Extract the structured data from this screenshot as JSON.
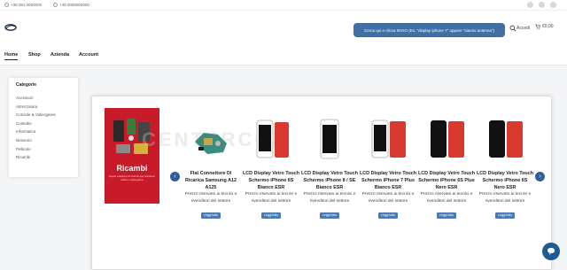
{
  "topbar": {
    "phone": "+39 081 0000000",
    "phone2": "+39 0000000000"
  },
  "header": {
    "search_label": "Cerca qui e clicca INVIO (Es. \"display iphone 7\" oppure \"xiaomi antenna\")",
    "account_label": "Accedi",
    "cart_label": "€0,00"
  },
  "nav": {
    "items": [
      "Home",
      "Shop",
      "Azienda",
      "Account"
    ]
  },
  "categories": {
    "title": "Categorie",
    "items": [
      "Accessori",
      "Attrezzatura",
      "Console & Videogame",
      "Custodie",
      "Informatica",
      "Nessuno",
      "Pellicole",
      "Ricambi"
    ]
  },
  "banner": {
    "title": "Ricambi",
    "subtitle": "Ampio catalogo di ricambi per telefonia, tablet e videogame"
  },
  "products": [
    {
      "name": "Flat Connettore Di Ricarica Samsung A12 A125",
      "note": "Prezzo riservato ai tecnici e rivenditori del settore",
      "button": "Leggi tutto"
    },
    {
      "name": "LCD Display Vetro Touch Schermo iPhone 6S Bianco ESR",
      "note": "Prezzo riservato ai tecnici e rivenditori del settore",
      "button": "Leggi tutto"
    },
    {
      "name": "LCD Display Vetro Touch Schermo iPhone 8 / SE Bianco ESR",
      "note": "Prezzo riservato ai tecnici e rivenditori del settore",
      "button": "Leggi tutto"
    },
    {
      "name": "LCD Display Vetro Touch Schermo iPhone 7 Plus Bianco ESR",
      "note": "Prezzo riservato ai tecnici e rivenditori del settore",
      "button": "Leggi tutto"
    },
    {
      "name": "LCD Display Vetro Touch Schermo iPhone 6S Plus Nero ESR",
      "note": "Prezzo riservato ai tecnici e rivenditori del settore",
      "button": "Leggi tutto"
    },
    {
      "name": "LCD Display Vetro Touch Schermo iPhone 6S Nero ESR",
      "note": "Prezzo riservato ai tecnici e rivenditori del settore",
      "button": "Leggi tutto"
    }
  ],
  "carousel": {
    "prev": "‹",
    "next": "›"
  },
  "watermark": "CENTERCOM",
  "colors": {
    "accent": "#3f6fa3",
    "banner": "#c81b2a",
    "chat": "#1f5a92"
  }
}
